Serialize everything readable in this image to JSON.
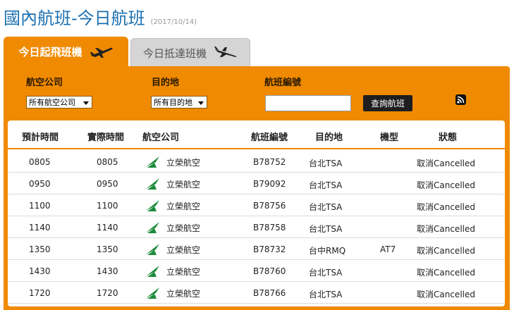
{
  "page": {
    "title": "國內航班-今日航班",
    "date": "(2017/10/14)"
  },
  "tabs": [
    {
      "label": "今日起飛班機",
      "icon": "departure-plane-icon",
      "active": true
    },
    {
      "label": "今日抵達班機",
      "icon": "arrival-plane-icon",
      "active": false
    }
  ],
  "filters": {
    "airline_label": "航空公司",
    "airline_value": "所有航空公司",
    "destination_label": "目的地",
    "destination_value": "所有目的地",
    "flight_no_label": "航班編號",
    "flight_no_value": "",
    "search_button": "查詢航班",
    "rss_icon": "rss-icon"
  },
  "table": {
    "headers": [
      "預計時間",
      "實際時間",
      "航空公司",
      "航班編號",
      "目的地",
      "機型",
      "狀態"
    ],
    "rows": [
      {
        "scheduled": "0805",
        "actual": "0805",
        "airline": "立榮航空",
        "flight": "B78752",
        "dest": "台北TSA",
        "aircraft": "",
        "status": "取消Cancelled"
      },
      {
        "scheduled": "0950",
        "actual": "0950",
        "airline": "立榮航空",
        "flight": "B79092",
        "dest": "台北TSA",
        "aircraft": "",
        "status": "取消Cancelled"
      },
      {
        "scheduled": "1100",
        "actual": "1100",
        "airline": "立榮航空",
        "flight": "B78756",
        "dest": "台北TSA",
        "aircraft": "",
        "status": "取消Cancelled"
      },
      {
        "scheduled": "1140",
        "actual": "1140",
        "airline": "立榮航空",
        "flight": "B78758",
        "dest": "台北TSA",
        "aircraft": "",
        "status": "取消Cancelled"
      },
      {
        "scheduled": "1350",
        "actual": "1350",
        "airline": "立榮航空",
        "flight": "B78732",
        "dest": "台中RMQ",
        "aircraft": "AT7",
        "status": "取消Cancelled"
      },
      {
        "scheduled": "1430",
        "actual": "1430",
        "airline": "立榮航空",
        "flight": "B78760",
        "dest": "台北TSA",
        "aircraft": "",
        "status": "取消Cancelled"
      },
      {
        "scheduled": "1720",
        "actual": "1720",
        "airline": "立榮航空",
        "flight": "B78766",
        "dest": "台北TSA",
        "aircraft": "",
        "status": "取消Cancelled"
      }
    ]
  },
  "colors": {
    "accent": "#f08a00",
    "title": "#1a6fb0",
    "airline_logo": "#1c8a3a"
  }
}
